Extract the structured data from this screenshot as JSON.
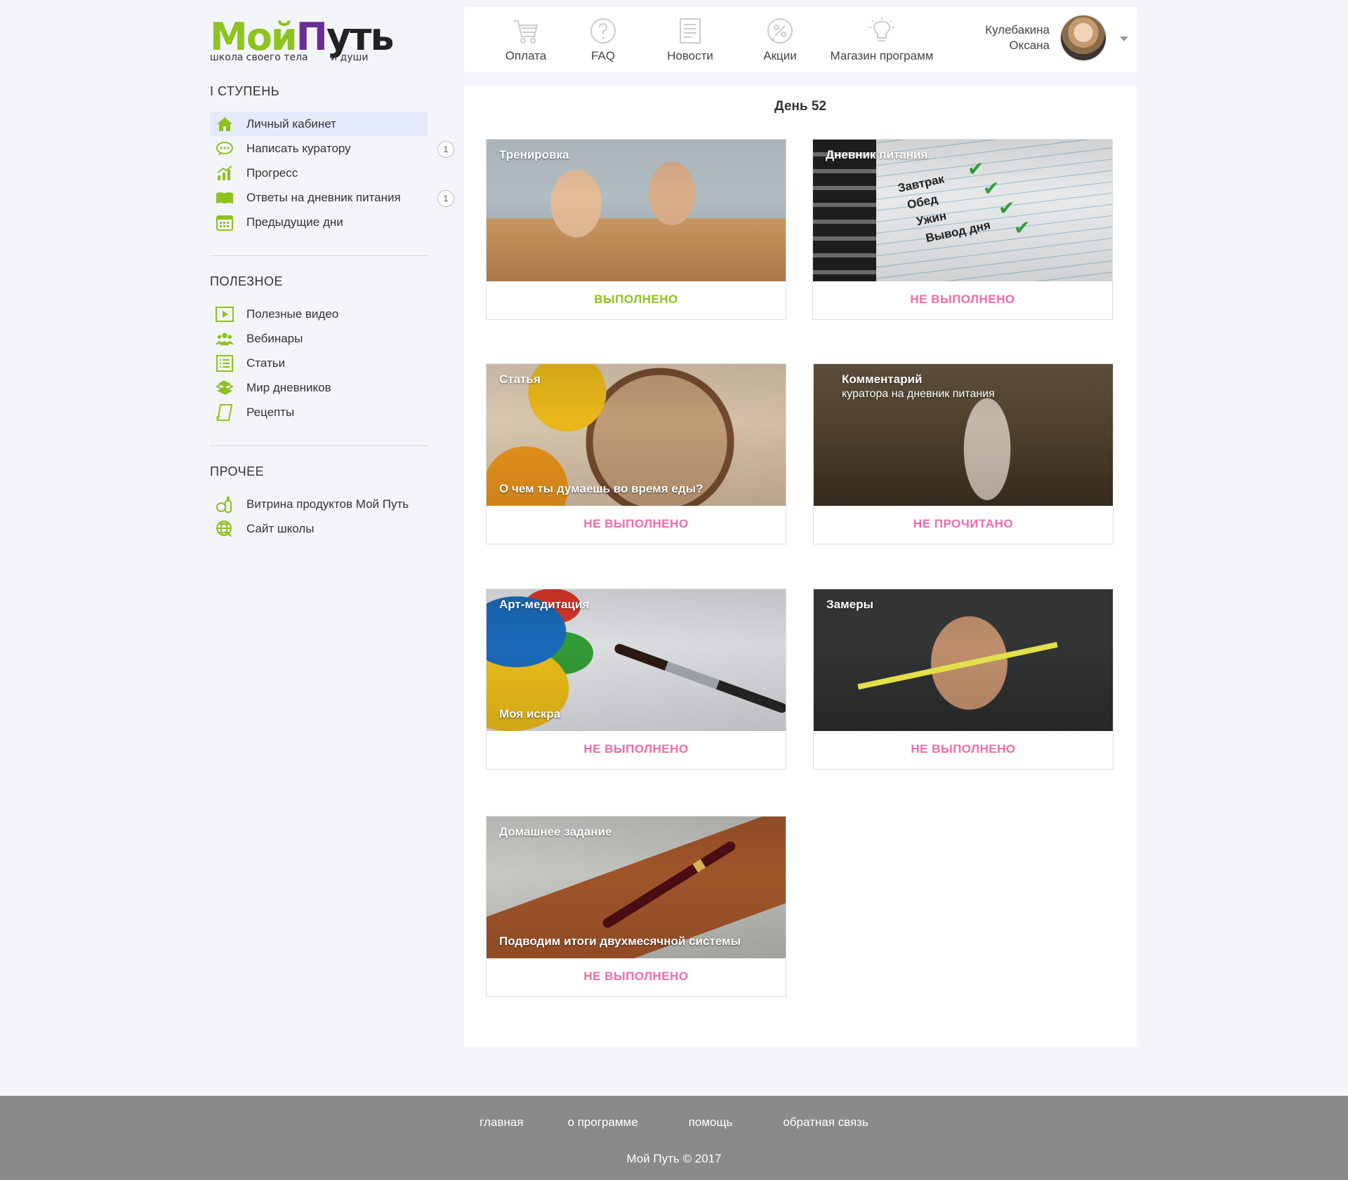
{
  "logo": {
    "word1": "Мой",
    "word2": "П",
    "word3": "уть",
    "tagline1": "школа своего тела",
    "tagline2": "и души"
  },
  "sidebar": {
    "sections": [
      {
        "title": "I СТУПЕНЬ",
        "items": [
          {
            "label": "Личный кабинет",
            "icon": "home-icon",
            "active": true
          },
          {
            "label": "Написать куратору",
            "icon": "chat-icon",
            "badge": "1"
          },
          {
            "label": "Прогресс",
            "icon": "progress-chart-icon"
          },
          {
            "label": "Ответы на дневник питания",
            "icon": "open-book-icon",
            "badge": "1"
          },
          {
            "label": "Предыдущие дни",
            "icon": "calendar-icon"
          }
        ]
      },
      {
        "title": "ПОЛЕЗНОЕ",
        "items": [
          {
            "label": "Полезные видео",
            "icon": "video-play-icon"
          },
          {
            "label": "Вебинары",
            "icon": "people-group-icon"
          },
          {
            "label": "Статьи",
            "icon": "list-icon"
          },
          {
            "label": "Мир дневников",
            "icon": "books-stack-icon"
          },
          {
            "label": "Рецепты",
            "icon": "recipe-note-icon"
          }
        ]
      },
      {
        "title": "ПРОЧЕЕ",
        "items": [
          {
            "label": "Витрина продуктов Мой Путь",
            "icon": "products-icon"
          },
          {
            "label": "Сайт школы",
            "icon": "globe-icon"
          }
        ]
      }
    ]
  },
  "topnav": {
    "items": [
      {
        "label": "Оплата",
        "icon": "cart-icon"
      },
      {
        "label": "FAQ",
        "icon": "question-icon"
      },
      {
        "label": "Новости",
        "icon": "news-doc-icon"
      },
      {
        "label": "Акции",
        "icon": "percent-badge-icon"
      },
      {
        "label": "Магазин программ",
        "icon": "lightbulb-icon"
      }
    ],
    "user": {
      "last_name": "Кулебакина",
      "first_name": "Оксана"
    }
  },
  "main": {
    "day_title": "День 52",
    "cards": [
      {
        "title": "Тренировка",
        "subtitle": "",
        "status": "ВЫПОЛНЕНО",
        "done": true
      },
      {
        "title": "Дневник питания",
        "subtitle": "",
        "status": "НЕ ВЫПОЛНЕНО",
        "done": false,
        "notebook_lines": [
          "Завтрак",
          "Обед",
          "Ужин",
          "Вывод дня"
        ]
      },
      {
        "title": "Статья",
        "subtitle": "О чем ты думаешь во время еды?",
        "status": "НЕ ВЫПОЛНЕНО",
        "done": false
      },
      {
        "title": "Комментарий",
        "subtitle_top": "куратора на дневник питания",
        "status": "НЕ ПРОЧИТАНО",
        "done": false
      },
      {
        "title": "Арт-медитация",
        "subtitle": "Моя искра",
        "status": "НЕ ВЫПОЛНЕНО",
        "done": false
      },
      {
        "title": "Замеры",
        "subtitle": "",
        "status": "НЕ ВЫПОЛНЕНО",
        "done": false
      },
      {
        "title": "Домашнее задание",
        "subtitle": "Подводим итоги двухмесячной системы",
        "status": "НЕ ВЫПОЛНЕНО",
        "done": false
      }
    ]
  },
  "footer": {
    "links": [
      "главная",
      "о программе",
      "помощь",
      "обратная связь"
    ],
    "copyright": "Мой Путь © 2017"
  },
  "colors": {
    "brand_green": "#8dc21f",
    "brand_purple": "#6a2d91",
    "status_done": "#8dc21f",
    "status_todo": "#f06ba8",
    "active_menu_bg": "#e6ebfb",
    "footer_bg": "#8a8a8a"
  }
}
